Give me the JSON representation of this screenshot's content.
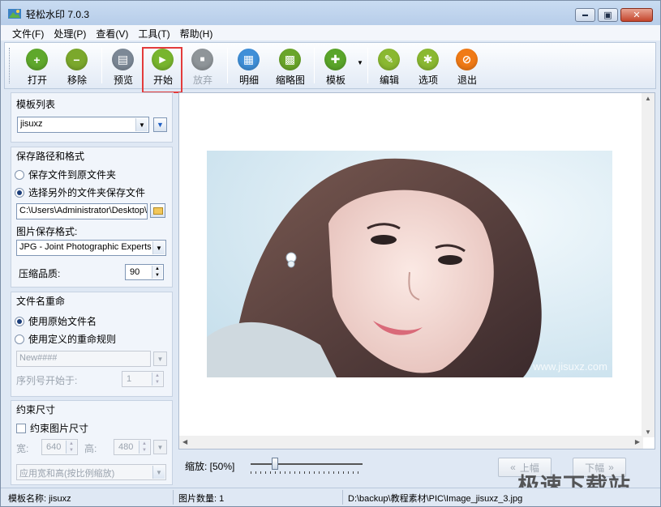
{
  "window": {
    "title": "轻松水印 7.0.3",
    "minimize_symbol": "▬",
    "maximize_symbol": "▣",
    "close_symbol": "✕"
  },
  "menu": [
    "文件(F)",
    "处理(P)",
    "查看(V)",
    "工具(T)",
    "帮助(H)"
  ],
  "toolbar": [
    {
      "label": "打开",
      "icon": "plus-icon",
      "glyph": "+",
      "color": "#5fa82c"
    },
    {
      "label": "移除",
      "icon": "minus-icon",
      "glyph": "−",
      "color": "#7ba82c"
    },
    {
      "label": "预览",
      "icon": "preview-icon",
      "glyph": "▤",
      "color": "#7c8896"
    },
    {
      "label": "开始",
      "icon": "play-icon",
      "glyph": "▶",
      "color": "#78b52e"
    },
    {
      "label": "放弃",
      "icon": "stop-icon",
      "glyph": "■",
      "color": "#8f9599",
      "disabled": true
    },
    {
      "label": "明细",
      "icon": "details-icon",
      "glyph": "▦",
      "color": "#3f8fd8"
    },
    {
      "label": "缩略图",
      "icon": "thumbnails-icon",
      "glyph": "▩",
      "color": "#6aa52a"
    },
    {
      "label": "模板",
      "icon": "puzzle-icon",
      "glyph": "✚",
      "color": "#5aa52a"
    },
    {
      "label": "编辑",
      "icon": "pencil-icon",
      "glyph": "✎",
      "color": "#8ab831"
    },
    {
      "label": "选项",
      "icon": "wrench-icon",
      "glyph": "✱",
      "color": "#8ab831"
    },
    {
      "label": "退出",
      "icon": "exit-icon",
      "glyph": "⊘",
      "color": "#f07a16"
    }
  ],
  "template_list": {
    "title": "模板列表",
    "selected": "jisuxz"
  },
  "save_path": {
    "title": "保存路径和格式",
    "option_original": "保存文件到原文件夹",
    "option_other": "选择另外的文件夹保存文件",
    "path_value": "C:\\Users\\Administrator\\Desktop\\",
    "format_label": "图片保存格式:",
    "format_value": "JPG - Joint Photographic Experts G",
    "quality_label": "压缩品质:",
    "quality_value": "90"
  },
  "rename": {
    "title": "文件名重命",
    "option_original": "使用原始文件名",
    "option_custom": "使用定义的重命规则",
    "pattern_value": "New####",
    "seq_label": "序列号开始于:",
    "seq_value": "1"
  },
  "size": {
    "title": "约束尺寸",
    "constrain_label": "约束图片尺寸",
    "width_label": "宽:",
    "width_value": "640",
    "height_label": "高:",
    "height_value": "480",
    "mode_value": "应用宽和高(按比例缩放)"
  },
  "preview": {
    "watermark": "www.jisuxz.com"
  },
  "zoom": {
    "label": "缩放: [50%]",
    "level": 0.2
  },
  "nav": {
    "prev": "上幅",
    "next": "下幅"
  },
  "status": {
    "template_name": "模板名称: jisuxz",
    "image_count": "图片数量:  1",
    "file_path": "D:\\backup\\教程素材\\PIC\\Image_jisuxz_3.jpg"
  },
  "site_watermark": "极速下载站"
}
